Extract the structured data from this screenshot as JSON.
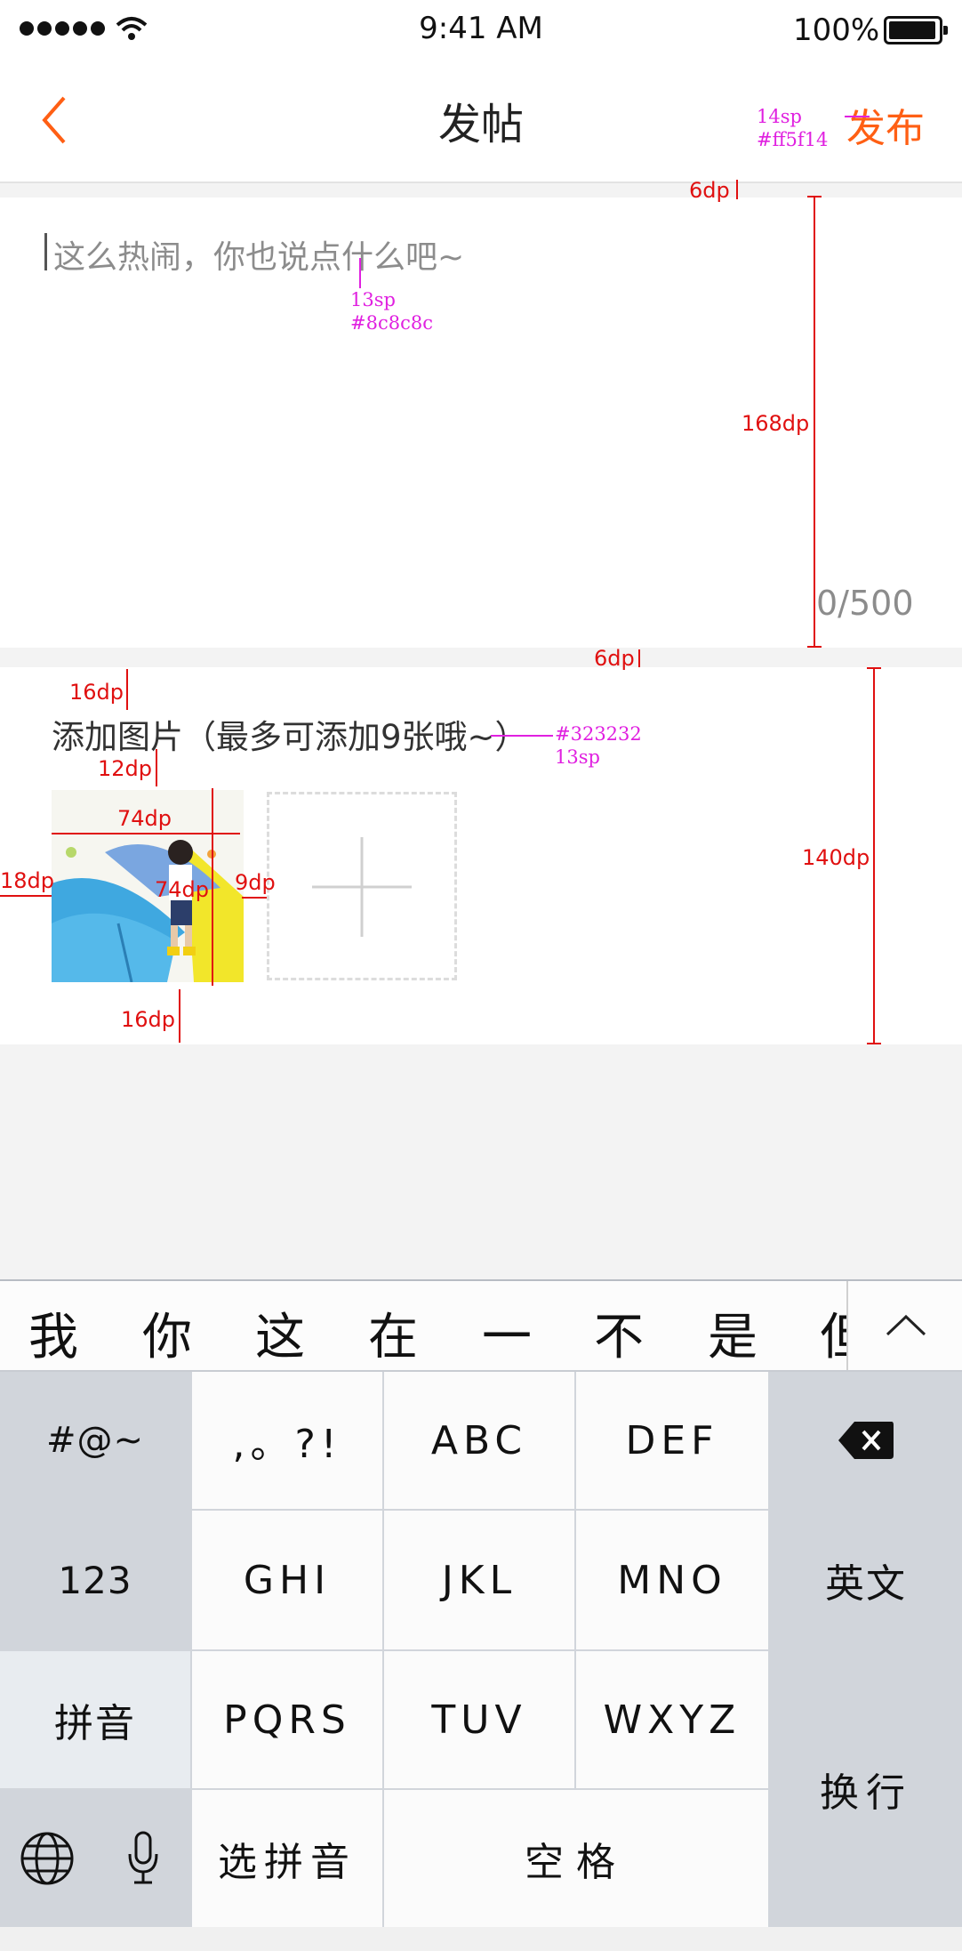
{
  "status_bar": {
    "time": "9:41 AM",
    "battery": "100%"
  },
  "nav": {
    "title": "发帖",
    "publish_label": "发布",
    "back_icon": "chevron-left-icon"
  },
  "colors": {
    "accent": "#ff5f14",
    "placeholder": "#8c8c8c",
    "text": "#323232"
  },
  "editor": {
    "placeholder": "这么热闹，你也说点什么吧~",
    "counter": "0/500"
  },
  "images": {
    "title": "添加图片（最多可添加9张哦~）"
  },
  "annotations": {
    "publish_spec": "14sp\n#ff5f14",
    "placeholder_spec": "13sp\n#8c8c8c",
    "title_spec": "#323232\n13sp",
    "gap_top": "6dp",
    "editor_height": "168dp",
    "gap_mid": "6dp",
    "pad_16_top": "16dp",
    "pad_12": "12dp",
    "thumb_width": "74dp",
    "thumb_height": "74dp",
    "pad_18": "18dp",
    "gap_9": "9dp",
    "pad_16_bottom": "16dp",
    "section_height": "140dp"
  },
  "keyboard": {
    "candidates": [
      "我",
      "你",
      "这",
      "在",
      "一",
      "不",
      "是",
      "但"
    ],
    "rows": [
      [
        "#@~",
        ",。?!",
        "ABC",
        "DEF",
        "delete"
      ],
      [
        "123",
        "GHI",
        "JKL",
        "MNO",
        "英文"
      ],
      [
        "拼音",
        "PQRS",
        "TUV",
        "WXYZ",
        "换行"
      ],
      [
        "globe",
        "mic",
        "选拼音",
        "空格"
      ]
    ]
  }
}
